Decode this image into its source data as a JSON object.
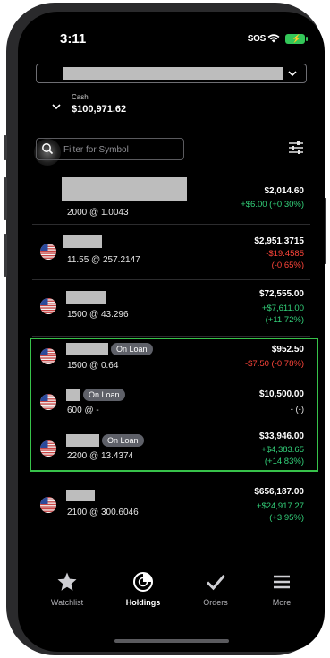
{
  "status_bar": {
    "time": "3:11",
    "sos": "SOS"
  },
  "account": {
    "chevron_icon": "chevron-down-icon"
  },
  "cash": {
    "label": "Cash",
    "value": "$100,971.62"
  },
  "search": {
    "placeholder": "Filter for Symbol",
    "icon": "search-icon"
  },
  "filter_icon": "sliders-icon",
  "holdings": [
    {
      "flag": false,
      "quantity_price": "2000 @ 1.0043",
      "market_value": "$2,014.60",
      "change_line1": "+$6.00 (+0.30%)",
      "change_line2": "",
      "direction": "pos",
      "on_loan": false
    },
    {
      "flag": true,
      "quantity_price": "11.55 @ 257.2147",
      "market_value": "$2,951.3715",
      "change_line1": "-$19.4585",
      "change_line2": "(-0.65%)",
      "direction": "neg",
      "on_loan": false
    },
    {
      "flag": true,
      "quantity_price": "1500 @ 43.296",
      "market_value": "$72,555.00",
      "change_line1": "+$7,611.00",
      "change_line2": "(+11.72%)",
      "direction": "pos",
      "on_loan": false
    },
    {
      "flag": true,
      "quantity_price": "1500 @ 0.64",
      "market_value": "$952.50",
      "change_line1": "-$7.50 (-0.78%)",
      "change_line2": "",
      "direction": "neg",
      "on_loan": true
    },
    {
      "flag": true,
      "quantity_price": "600 @ -",
      "market_value": "$10,500.00",
      "change_line1": "- (-)",
      "change_line2": "",
      "direction": "neutral",
      "on_loan": true
    },
    {
      "flag": true,
      "quantity_price": "2200 @ 13.4374",
      "market_value": "$33,946.00",
      "change_line1": "+$4,383.65",
      "change_line2": "(+14.83%)",
      "direction": "pos",
      "on_loan": true
    },
    {
      "flag": true,
      "quantity_price": "2100 @ 300.6046",
      "market_value": "$656,187.00",
      "change_line1": "+$24,917.27",
      "change_line2": "(+3.95%)",
      "direction": "pos",
      "on_loan": false
    }
  ],
  "badge_label": "On Loan",
  "tabs": [
    {
      "label": "Watchlist",
      "icon": "star-icon",
      "active": false
    },
    {
      "label": "Holdings",
      "icon": "pie-chart-icon",
      "active": true
    },
    {
      "label": "Orders",
      "icon": "checkmark-icon",
      "active": false
    },
    {
      "label": "More",
      "icon": "menu-icon",
      "active": false
    }
  ],
  "colors": {
    "positive": "#33d17a",
    "negative": "#ff453a",
    "highlight_border": "#37c24a",
    "badge_bg": "#5e6068"
  }
}
